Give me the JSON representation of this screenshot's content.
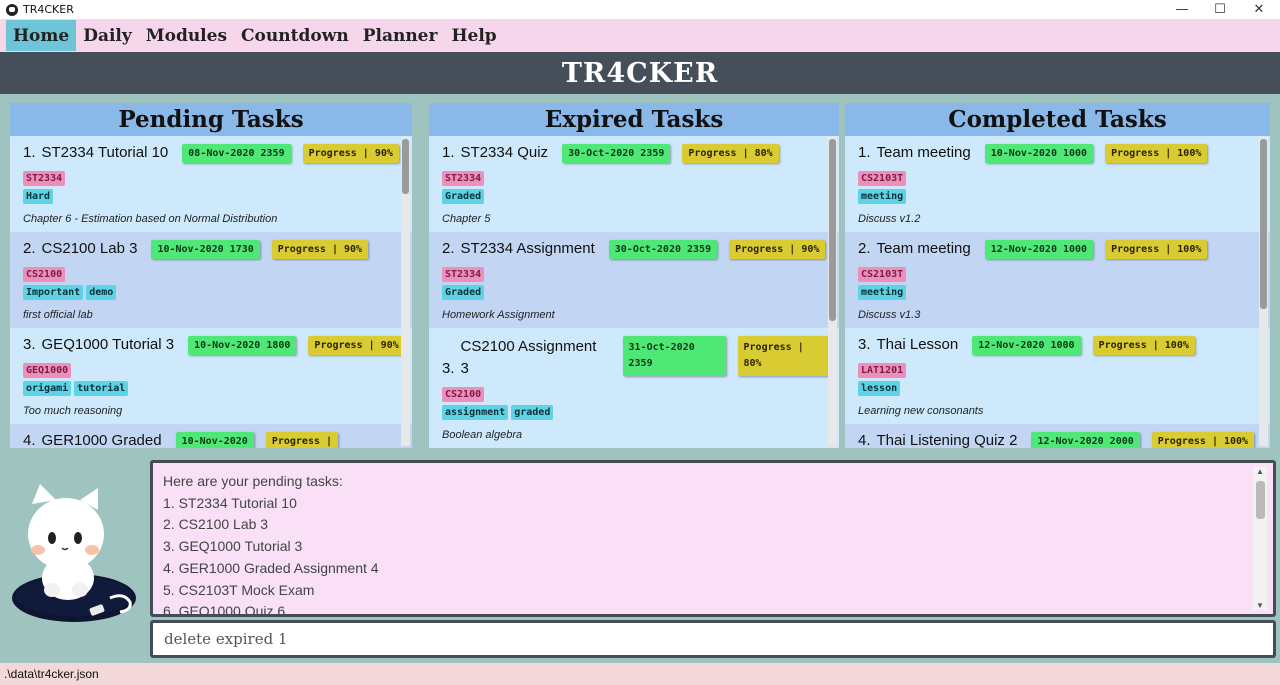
{
  "window": {
    "title": "TR4CKER",
    "minimize": "—",
    "maximize": "☐",
    "close": "✕"
  },
  "menu": [
    {
      "label": "Home",
      "active": true
    },
    {
      "label": "Daily"
    },
    {
      "label": "Modules"
    },
    {
      "label": "Countdown"
    },
    {
      "label": "Planner"
    },
    {
      "label": "Help"
    }
  ],
  "header": {
    "title": "TR4CKER"
  },
  "panels": [
    {
      "title": "Pending Tasks",
      "tasks": [
        {
          "num": "1.",
          "name": "ST2334 Tutorial 10",
          "due": "08-Nov-2020 2359",
          "progress": "Progress | 90%",
          "module": "ST2334",
          "tags": [
            "Hard"
          ],
          "desc": "Chapter 6 - Estimation based on Normal Distribution"
        },
        {
          "num": "2.",
          "name": "CS2100 Lab 3",
          "due": "10-Nov-2020 1730",
          "progress": "Progress | 90%",
          "module": "CS2100",
          "tags": [
            "Important",
            "demo"
          ],
          "desc": "first official lab"
        },
        {
          "num": "3.",
          "name": "GEQ1000 Tutorial 3",
          "due": "10-Nov-2020 1800",
          "progress": "Progress | 90%",
          "module": "GEQ1000",
          "tags": [
            "origami",
            "tutorial"
          ],
          "desc": "Too much reasoning"
        },
        {
          "num": "4.",
          "name": "GER1000 Graded",
          "due": "10-Nov-2020",
          "progress": "Progress |",
          "module": "",
          "tags": [],
          "desc": ""
        }
      ]
    },
    {
      "title": "Expired Tasks",
      "tasks": [
        {
          "num": "1.",
          "name": "ST2334 Quiz",
          "due": "30-Oct-2020 2359",
          "progress": "Progress | 80%",
          "module": "ST2334",
          "tags": [
            "Graded"
          ],
          "desc": "Chapter 5"
        },
        {
          "num": "2.",
          "name": "ST2334 Assignment",
          "due": "30-Oct-2020 2359",
          "progress": "Progress | 90%",
          "module": "ST2334",
          "tags": [
            "Graded"
          ],
          "desc": "Homework Assignment"
        },
        {
          "num": "3.",
          "name": "CS2100 Assignment 3",
          "due": "31-Oct-2020 2359",
          "progress": "Progress | 80%",
          "module": "CS2100",
          "tags": [
            "assignment",
            "graded"
          ],
          "desc": "Boolean algebra"
        }
      ]
    },
    {
      "title": "Completed Tasks",
      "tasks": [
        {
          "num": "1.",
          "name": "Team meeting",
          "due": "10-Nov-2020 1000",
          "progress": "Progress | 100%",
          "module": "CS2103T",
          "tags": [
            "meeting"
          ],
          "desc": "Discuss v1.2"
        },
        {
          "num": "2.",
          "name": "Team meeting",
          "due": "12-Nov-2020 1000",
          "progress": "Progress | 100%",
          "module": "CS2103T",
          "tags": [
            "meeting"
          ],
          "desc": "Discuss v1.3"
        },
        {
          "num": "3.",
          "name": "Thai Lesson",
          "due": "12-Nov-2020 1000",
          "progress": "Progress | 100%",
          "module": "LAT1201",
          "tags": [
            "lesson"
          ],
          "desc": "Learning new consonants"
        },
        {
          "num": "4.",
          "name": "Thai Listening Quiz 2",
          "due": "12-Nov-2020 2000",
          "progress": "Progress | 100%",
          "module": "",
          "tags": [],
          "desc": ""
        }
      ]
    }
  ],
  "result": {
    "lines": [
      "Here are your pending tasks:",
      "1. ST2334 Tutorial 10",
      "2. CS2100 Lab 3",
      "3. GEQ1000 Tutorial 3",
      "4. GER1000 Graded Assignment 4",
      "5. CS2103T Mock Exam",
      "6. GEQ1000 Quiz 6"
    ]
  },
  "command": {
    "value": "delete expired 1"
  },
  "status": {
    "path": ".\\data\\tr4cker.json"
  },
  "mascot": {
    "icon": "cat-mascot-icon"
  }
}
